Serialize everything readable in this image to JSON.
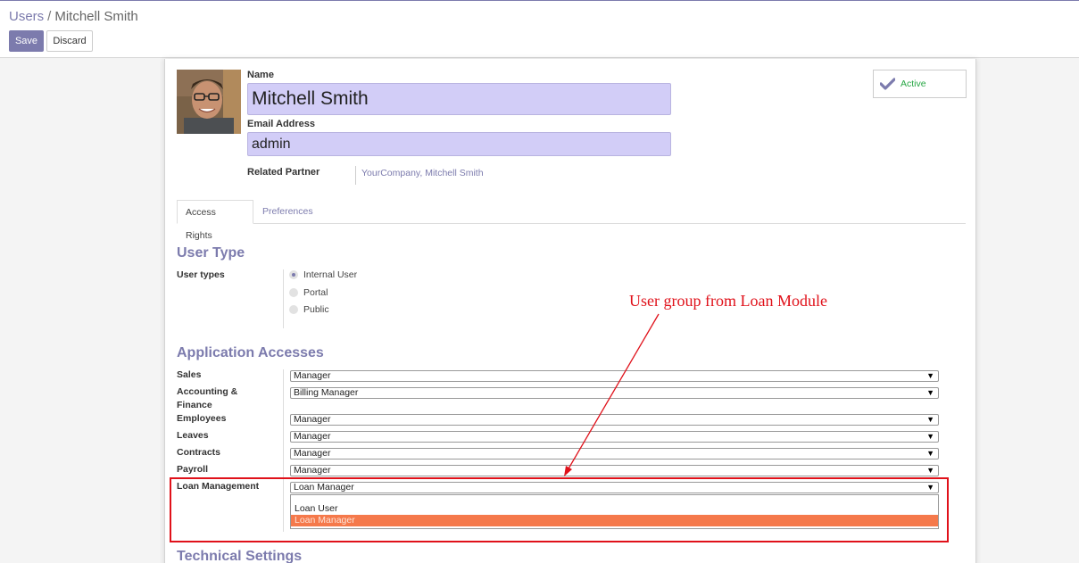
{
  "colors": {
    "brand": "#7c7bad",
    "field_highlight": "#d2cdf7",
    "active_green": "#28a745",
    "annotation_red": "#e0111a",
    "selected_option": "#f5794b"
  },
  "breadcrumb": {
    "parent": "Users",
    "separator": "/",
    "current": "Mitchell Smith"
  },
  "toolbar": {
    "save_label": "Save",
    "discard_label": "Discard"
  },
  "form": {
    "name_label": "Name",
    "name_value": "Mitchell Smith",
    "email_label": "Email Address",
    "email_value": "admin",
    "partner_label": "Related Partner",
    "partner_value": "YourCompany, Mitchell Smith",
    "active_label": "Active",
    "active_icon": "check-icon"
  },
  "tabs": [
    {
      "label": "Access Rights",
      "active": true
    },
    {
      "label": "Preferences",
      "active": false
    }
  ],
  "user_type": {
    "title": "User Type",
    "label": "User types",
    "options": [
      {
        "label": "Internal User",
        "checked": true
      },
      {
        "label": "Portal",
        "checked": false
      },
      {
        "label": "Public",
        "checked": false
      }
    ]
  },
  "app_access": {
    "title": "Application Accesses",
    "rows": [
      {
        "label": "Sales",
        "value": "Manager"
      },
      {
        "label": "Accounting & Finance",
        "value": "Billing Manager"
      },
      {
        "label": "Employees",
        "value": "Manager"
      },
      {
        "label": "Leaves",
        "value": "Manager"
      },
      {
        "label": "Contracts",
        "value": "Manager"
      },
      {
        "label": "Payroll",
        "value": "Manager"
      },
      {
        "label": "Loan Management",
        "value": "Loan Manager"
      }
    ],
    "dropdown_options": [
      "Loan User",
      "Loan Manager"
    ],
    "arrow_glyph": "▼"
  },
  "technical_title": "Technical Settings",
  "annotation": {
    "text": "User group from Loan Module"
  }
}
